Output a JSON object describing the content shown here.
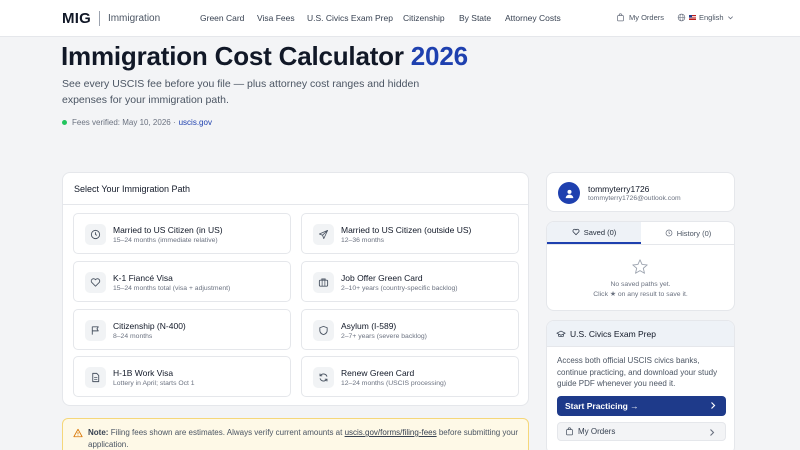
{
  "header": {
    "logo": "MIG",
    "product": "Immigration",
    "nav": [
      "Green Card",
      "Visa Fees",
      "U.S. Civics Exam Prep",
      "Citizenship",
      "By State",
      "Attorney Costs"
    ],
    "orders": "My Orders",
    "language": "English"
  },
  "hero": {
    "title": "Immigration Cost Calculator",
    "year": "2026",
    "subtitle": "See every USCIS fee before you file — plus attorney cost ranges and hidden expenses for your immigration path.",
    "verified": "Fees verified: May 10, 2026 ·",
    "source": "uscis.gov"
  },
  "paths": {
    "title": "Select Your Immigration Path",
    "items": [
      {
        "title": "Married to US Citizen (in US)",
        "sub": "15–24 months (immediate relative)",
        "icon": "clock-icon"
      },
      {
        "title": "Married to US Citizen (outside US)",
        "sub": "12–36 months",
        "icon": "plane-icon"
      },
      {
        "title": "K-1 Fiancé Visa",
        "sub": "15–24 months total (visa + adjustment)",
        "icon": "heart-icon"
      },
      {
        "title": "Job Offer Green Card",
        "sub": "2–10+ years (country-specific backlog)",
        "icon": "briefcase-icon"
      },
      {
        "title": "Citizenship (N-400)",
        "sub": "8–24 months",
        "icon": "flag-icon"
      },
      {
        "title": "Asylum (I-589)",
        "sub": "2–7+ years (severe backlog)",
        "icon": "shield-icon"
      },
      {
        "title": "H-1B Work Visa",
        "sub": "Lottery in April; starts Oct 1",
        "icon": "document-icon"
      },
      {
        "title": "Renew Green Card",
        "sub": "12–24 months (USCIS processing)",
        "icon": "refresh-icon"
      }
    ]
  },
  "note": {
    "label": "Note:",
    "text_before": "Filing fees shown are estimates. Always verify current amounts at",
    "link": "uscis.gov/forms/filing-fees",
    "text_after": "before submitting your application."
  },
  "user": {
    "name": "tommyterry1726",
    "email": "tommyterry1726@outlook.com"
  },
  "saved": {
    "tab_saved": "Saved (0)",
    "tab_history": "History (0)",
    "empty_line1": "No saved paths yet.",
    "empty_line2": "Click ★ on any result to save it."
  },
  "civics": {
    "title": "U.S. Civics Exam Prep",
    "description": "Access both official USCIS civics banks, continue practicing, and download your study guide PDF whenever you need it.",
    "primary_button": "Start Practicing →",
    "secondary_button": "My Orders"
  },
  "colors": {
    "accent": "#1e40af",
    "button": "#1e3a8a",
    "verified_dot": "#22c55e",
    "note_bg": "#fef9e7"
  }
}
